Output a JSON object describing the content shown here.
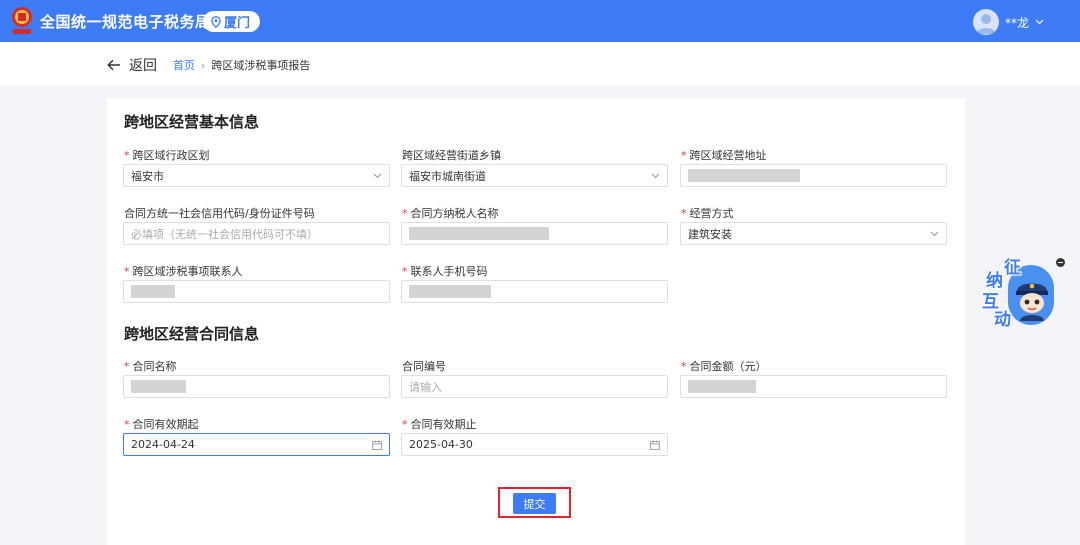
{
  "header": {
    "site_title": "全国统一规范电子税务局",
    "city": "厦门",
    "user_name": "**龙"
  },
  "nav": {
    "back_label": "返回",
    "breadcrumb_home": "首页",
    "breadcrumb_separator": "›",
    "breadcrumb_current": "跨区域涉税事项报告"
  },
  "section_basic": {
    "title": "跨地区经营基本信息",
    "admin_division": {
      "label": "跨区域行政区划",
      "required": "*",
      "value": "福安市",
      "icon": "chevron-down-icon"
    },
    "street_town": {
      "label": "跨区域经营街道乡镇",
      "value": "福安市城南街道",
      "icon": "chevron-down-icon"
    },
    "address": {
      "label": "跨区域经营地址",
      "required": "*",
      "value_redacted": true
    },
    "partner_credit_code": {
      "label": "合同方统一社会信用代码/身份证件号码",
      "placeholder": "必填项（无统一社会信用代码可不填）"
    },
    "partner_name": {
      "label": "合同方纳税人名称",
      "required": "*",
      "value_redacted": true
    },
    "business_mode": {
      "label": "经营方式",
      "required": "*",
      "value": "建筑安装",
      "icon": "chevron-down-icon"
    },
    "contact_person": {
      "label": "跨区域涉税事项联系人",
      "required": "*",
      "value_redacted": true
    },
    "contact_phone": {
      "label": "联系人手机号码",
      "required": "*",
      "value_redacted": true
    }
  },
  "section_contract": {
    "title": "跨地区经营合同信息",
    "contract_name": {
      "label": "合同名称",
      "required": "*",
      "value_redacted": true
    },
    "contract_number": {
      "label": "合同编号",
      "placeholder": "请输入"
    },
    "contract_amount": {
      "label": "合同金额（元）",
      "required": "*",
      "value_redacted": true
    },
    "valid_from": {
      "label": "合同有效期起",
      "required": "*",
      "value": "2024-04-24",
      "icon": "calendar-icon"
    },
    "valid_to": {
      "label": "合同有效期止",
      "required": "*",
      "value": "2025-04-30",
      "icon": "calendar-icon"
    }
  },
  "actions": {
    "submit_label": "提交"
  },
  "helper_widget": {
    "chars": [
      "征",
      "纳",
      "互",
      "动"
    ]
  },
  "colors": {
    "primary": "#3d7cf6",
    "required": "#e23b3b",
    "highlight_frame": "#e0262b"
  }
}
